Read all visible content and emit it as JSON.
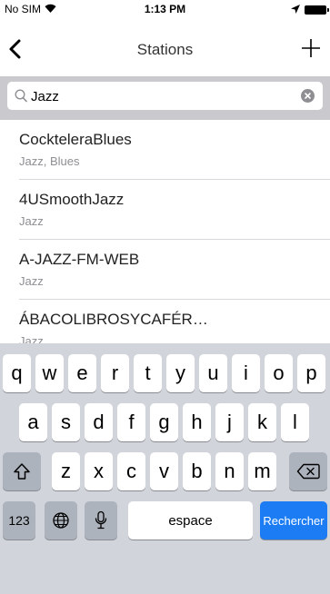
{
  "status_bar": {
    "carrier": "No SIM",
    "time": "1:13 PM"
  },
  "nav": {
    "title": "Stations"
  },
  "search": {
    "query": "Jazz"
  },
  "results": [
    {
      "name": "CockteleraBlues",
      "genre": "Jazz, Blues"
    },
    {
      "name": "4USmoothJazz",
      "genre": "Jazz"
    },
    {
      "name": "A-JAZZ-FM-WEB",
      "genre": "Jazz"
    },
    {
      "name": "ÁBACOLIBROSYCAFÉR…",
      "genre": "Jazz"
    }
  ],
  "keyboard": {
    "row1": [
      "q",
      "w",
      "e",
      "r",
      "t",
      "y",
      "u",
      "i",
      "o",
      "p"
    ],
    "row2": [
      "a",
      "s",
      "d",
      "f",
      "g",
      "h",
      "j",
      "k",
      "l"
    ],
    "row3": [
      "z",
      "x",
      "c",
      "v",
      "b",
      "n",
      "m"
    ],
    "numbers_label": "123",
    "space_label": "espace",
    "search_label": "Rechercher"
  }
}
